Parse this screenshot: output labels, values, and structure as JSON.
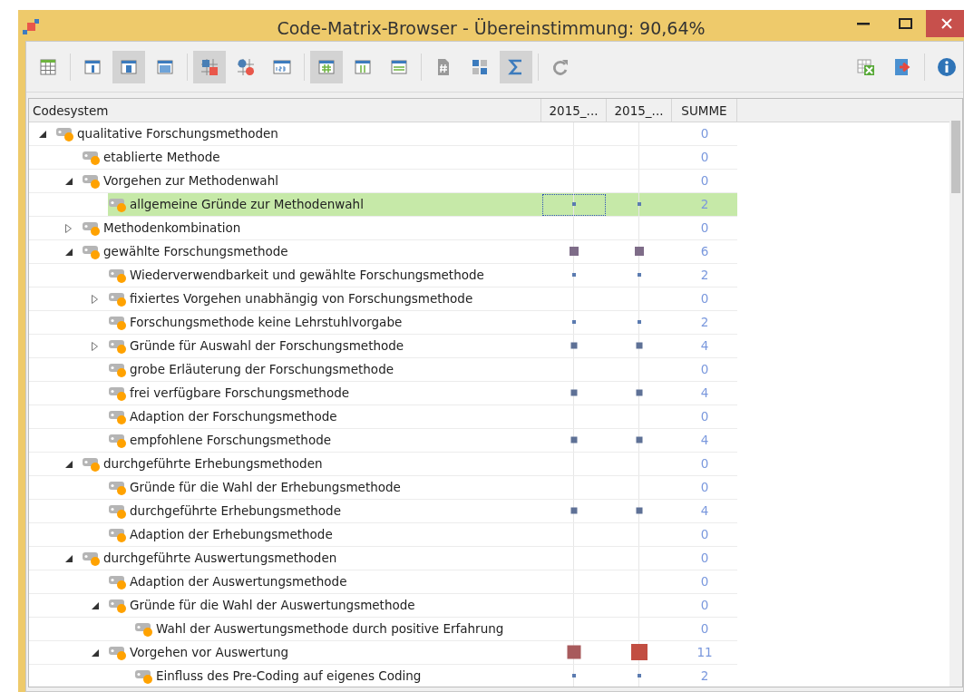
{
  "window": {
    "title": "Code-Matrix-Browser - Übereinstimmung: 90,64%"
  },
  "toolbar": {
    "left": [
      {
        "kind": "table",
        "pressed": false
      },
      {
        "kind": "sep"
      },
      {
        "kind": "col-narrow",
        "pressed": false
      },
      {
        "kind": "col-mid",
        "pressed": true
      },
      {
        "kind": "col-wide",
        "pressed": false
      },
      {
        "kind": "sep"
      },
      {
        "kind": "squares",
        "pressed": true
      },
      {
        "kind": "circles",
        "pressed": false
      },
      {
        "kind": "numbers",
        "pressed": false
      },
      {
        "kind": "sep"
      },
      {
        "kind": "hash-grid",
        "pressed": true
      },
      {
        "kind": "columns",
        "pressed": false
      },
      {
        "kind": "rows",
        "pressed": false
      },
      {
        "kind": "sep"
      },
      {
        "kind": "doc-hash",
        "pressed": false
      },
      {
        "kind": "ones",
        "pressed": false
      },
      {
        "kind": "sigma",
        "pressed": true
      },
      {
        "kind": "sep"
      },
      {
        "kind": "refresh",
        "pressed": false
      }
    ],
    "right": [
      {
        "kind": "excel"
      },
      {
        "kind": "export"
      },
      {
        "kind": "sep"
      },
      {
        "kind": "info"
      }
    ]
  },
  "table": {
    "columns": [
      "Codesystem",
      "2015_...",
      "2015_...",
      "SUMME"
    ],
    "rows": [
      {
        "label": "qualitative Forschungsmethoden",
        "expanded": true,
        "sum": "0",
        "selected": false,
        "children": [
          {
            "label": "etablierte Methode",
            "sum": "0",
            "selected": false
          },
          {
            "label": "Vorgehen zur Methodenwahl",
            "expanded": true,
            "sum": "0",
            "selected": false,
            "children": [
              {
                "label": "allgemeine Gründe zur Methodenwahl",
                "sum": "2",
                "selected": true,
                "marks": [
                  {
                    "kind": "tiny",
                    "color": "#5b7bb0"
                  },
                  {
                    "kind": "tiny",
                    "color": "#5b7bb0"
                  }
                ]
              }
            ]
          },
          {
            "label": "Methodenkombination",
            "expanded": false,
            "sum": "0",
            "selected": false
          },
          {
            "label": "gewählte Forschungsmethode",
            "expanded": true,
            "sum": "6",
            "selected": false,
            "marks": [
              {
                "kind": "medium",
                "color": "#7e6c88"
              },
              {
                "kind": "medium",
                "color": "#7e6c88"
              }
            ],
            "children": [
              {
                "label": "Wiederverwendbarkeit und gewählte Forschungsmethode",
                "sum": "2",
                "selected": false,
                "marks": [
                  {
                    "kind": "tiny",
                    "color": "#5b7bb0"
                  },
                  {
                    "kind": "tiny",
                    "color": "#5b7bb0"
                  }
                ]
              },
              {
                "label": "fixiertes Vorgehen unabhängig von Forschungsmethode",
                "expanded": false,
                "sum": "0",
                "selected": false
              },
              {
                "label": "Forschungsmethode keine Lehrstuhlvorgabe",
                "sum": "2",
                "selected": false,
                "marks": [
                  {
                    "kind": "tiny",
                    "color": "#5b7bb0"
                  },
                  {
                    "kind": "tiny",
                    "color": "#5b7bb0"
                  }
                ]
              },
              {
                "label": "Gründe für Auswahl der Forschungsmethode",
                "expanded": false,
                "sum": "4",
                "selected": false,
                "marks": [
                  {
                    "kind": "small",
                    "color": "#5e7196"
                  },
                  {
                    "kind": "small",
                    "color": "#5e7196"
                  }
                ]
              },
              {
                "label": "grobe Erläuterung der Forschungsmethode",
                "sum": "0",
                "selected": false
              },
              {
                "label": "frei verfügbare Forschungsmethode",
                "sum": "4",
                "selected": false,
                "marks": [
                  {
                    "kind": "small",
                    "color": "#5e7196"
                  },
                  {
                    "kind": "small",
                    "color": "#5e7196"
                  }
                ]
              },
              {
                "label": "Adaption der Forschungsmethode",
                "sum": "0",
                "selected": false
              },
              {
                "label": "empfohlene Forschungsmethode",
                "sum": "4",
                "selected": false,
                "marks": [
                  {
                    "kind": "small",
                    "color": "#5e7196"
                  },
                  {
                    "kind": "small",
                    "color": "#5e7196"
                  }
                ]
              }
            ]
          },
          {
            "label": "durchgeführte Erhebungsmethoden",
            "expanded": true,
            "sum": "0",
            "selected": false,
            "children": [
              {
                "label": "Gründe für die Wahl der Erhebungsmethode",
                "sum": "0",
                "selected": false
              },
              {
                "label": "durchgeführte Erhebungsmethode",
                "sum": "4",
                "selected": false,
                "marks": [
                  {
                    "kind": "small",
                    "color": "#5e7196"
                  },
                  {
                    "kind": "small",
                    "color": "#5e7196"
                  }
                ]
              },
              {
                "label": "Adaption der Erhebungsmethode",
                "sum": "0",
                "selected": false
              }
            ]
          },
          {
            "label": "durchgeführte Auswertungsmethoden",
            "expanded": true,
            "sum": "0",
            "selected": false,
            "children": [
              {
                "label": "Adaption der Auswertungsmethode",
                "sum": "0",
                "selected": false
              },
              {
                "label": "Gründe für die Wahl der Auswertungsmethode",
                "expanded": true,
                "sum": "0",
                "selected": false,
                "children": [
                  {
                    "label": "Wahl der Auswertungsmethode durch positive Erfahrung",
                    "sum": "0",
                    "selected": false
                  }
                ]
              },
              {
                "label": "Vorgehen vor Auswertung",
                "expanded": true,
                "sum": "11",
                "selected": false,
                "marks": [
                  {
                    "kind": "large",
                    "color": "#a85a5c"
                  },
                  {
                    "kind": "xlarge",
                    "color": "#c24e42"
                  }
                ],
                "children": [
                  {
                    "label": "Einfluss des Pre-Coding auf eigenes Coding",
                    "sum": "2",
                    "selected": false,
                    "marks": [
                      {
                        "kind": "tiny",
                        "color": "#5b7bb0"
                      },
                      {
                        "kind": "tiny",
                        "color": "#5b7bb0"
                      }
                    ]
                  }
                ]
              }
            ]
          }
        ]
      }
    ]
  }
}
